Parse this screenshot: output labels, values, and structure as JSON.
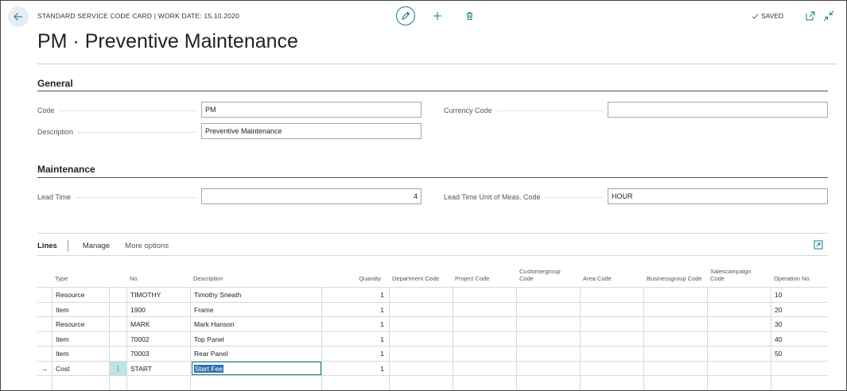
{
  "header": {
    "caption": "STANDARD SERVICE CODE CARD | WORK DATE: 15.10.2020",
    "saved_label": "SAVED",
    "title": "PM · Preventive Maintenance"
  },
  "general": {
    "heading": "General",
    "code_label": "Code",
    "code_value": "PM",
    "description_label": "Description",
    "description_value": "Preventive Maintenance",
    "currency_label": "Currency Code",
    "currency_value": ""
  },
  "maintenance": {
    "heading": "Maintenance",
    "lead_time_label": "Lead Time",
    "lead_time_value": "4",
    "lead_time_unit_label": "Lead Time Unit of Meas. Code",
    "lead_time_unit_value": "HOUR"
  },
  "lines": {
    "title": "Lines",
    "manage": "Manage",
    "more_options": "More options",
    "columns": {
      "type": "Type",
      "no": "No.",
      "description": "Description",
      "quantity": "Quantity",
      "department_code": "Department Code",
      "project_code": "Project Code",
      "customergroup_code": "Customergroup Code",
      "area_code": "Area Code",
      "businessgroup_code": "Businessgroup Code",
      "salescampaign_code": "Salescampaign Code",
      "operation_no": "Operation No."
    },
    "rows": [
      {
        "type": "Resource",
        "no": "TIMOTHY",
        "description": "Timothy Sneath",
        "quantity": "1",
        "operation_no": "10"
      },
      {
        "type": "Item",
        "no": "1900",
        "description": "Frame",
        "quantity": "1",
        "operation_no": "20"
      },
      {
        "type": "Resource",
        "no": "MARK",
        "description": "Mark Hanson",
        "quantity": "1",
        "operation_no": "30"
      },
      {
        "type": "Item",
        "no": "70002",
        "description": "Top Panel",
        "quantity": "1",
        "operation_no": "40"
      },
      {
        "type": "Item",
        "no": "70003",
        "description": "Rear Panel",
        "quantity": "1",
        "operation_no": "50"
      },
      {
        "type": "Cost",
        "no": "START",
        "description": "Start Fee",
        "quantity": "1",
        "operation_no": ""
      }
    ],
    "current_row_marker": "→",
    "row_menu_glyph": "⋮"
  },
  "icons": [
    "back-arrow-icon",
    "edit-pencil-icon",
    "plus-icon",
    "trash-icon",
    "checkmark-icon",
    "popout-icon",
    "collapse-icon",
    "expand-icon"
  ],
  "colors": {
    "accent": "#0f7c83",
    "selection": "#2f6fb3",
    "row_menu_bg": "#bfe4e8"
  }
}
